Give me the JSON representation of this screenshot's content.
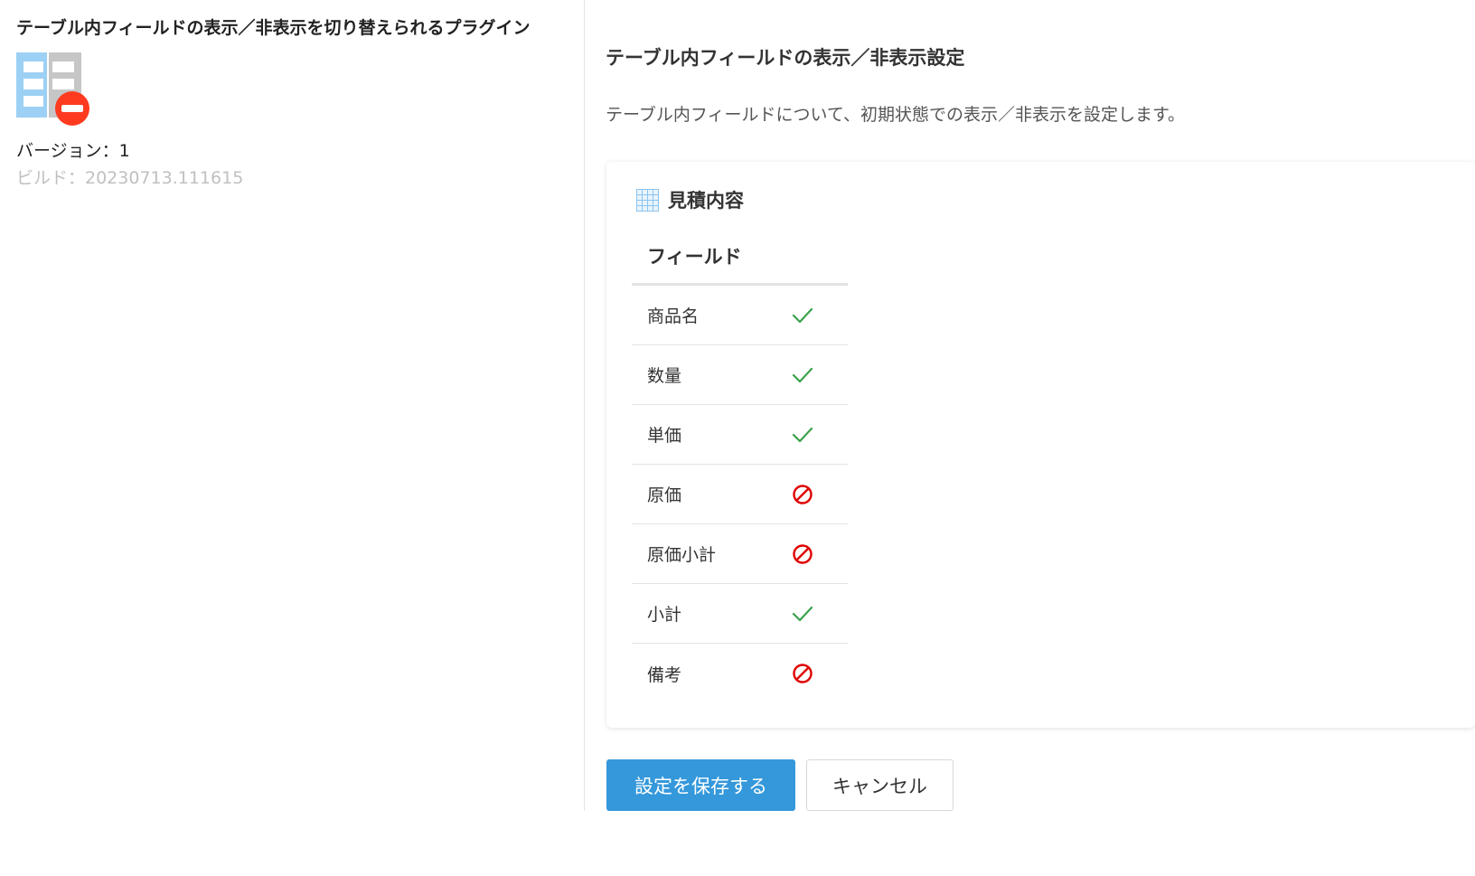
{
  "plugin": {
    "title": "テーブル内フィールドの表示／非表示を切り替えられるプラグイン",
    "icon": "table-hide-icon",
    "version": "バージョン：1",
    "build": "ビルド：20230713.111615"
  },
  "settings": {
    "title": "テーブル内フィールドの表示／非表示設定",
    "description": "テーブル内フィールドについて、初期状態での表示／非表示を設定します。"
  },
  "table": {
    "icon": "table-grid-icon",
    "name": "見積内容",
    "column_header": "フィールド",
    "fields": [
      {
        "label": "商品名",
        "visible": true
      },
      {
        "label": "数量",
        "visible": true
      },
      {
        "label": "単価",
        "visible": true
      },
      {
        "label": "原価",
        "visible": false
      },
      {
        "label": "原価小計",
        "visible": false
      },
      {
        "label": "小計",
        "visible": true
      },
      {
        "label": "備考",
        "visible": false
      }
    ]
  },
  "buttons": {
    "save_label": "設定を保存する",
    "cancel_label": "キャンセル"
  },
  "colors": {
    "primary": "#3498db",
    "visible_check": "#3aa14a",
    "hidden_mark": "#e00000",
    "icon_blue": "#9dd0f5",
    "icon_gray": "#c6c6c6",
    "icon_red": "#ff3b1f"
  }
}
